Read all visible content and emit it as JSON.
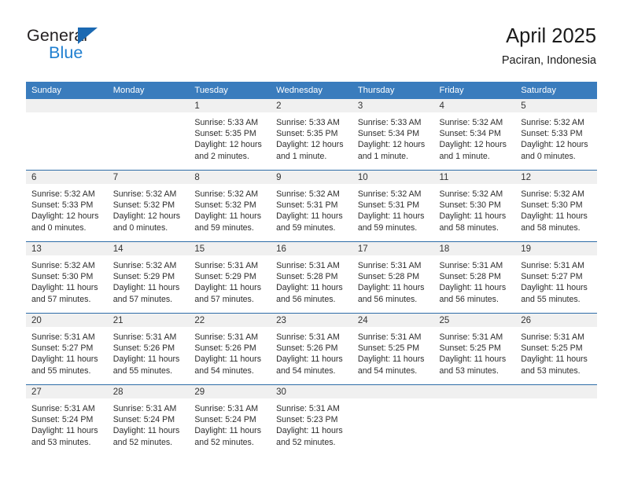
{
  "brand": {
    "name_part1": "General",
    "name_part2": "Blue",
    "triangle_color": "#1b69b2",
    "blue_color": "#1f7fd0"
  },
  "header": {
    "title": "April 2025",
    "subtitle": "Paciran, Indonesia"
  },
  "theme": {
    "header_bar": "#3a7cbd",
    "daynum_band": "#f0f0f0",
    "week_divider": "#2e6da8"
  },
  "weekdays": [
    "Sunday",
    "Monday",
    "Tuesday",
    "Wednesday",
    "Thursday",
    "Friday",
    "Saturday"
  ],
  "labels": {
    "sunrise_prefix": "Sunrise:",
    "sunset_prefix": "Sunset:",
    "daylight_prefix": "Daylight:"
  },
  "weeks": [
    [
      {
        "day": "",
        "empty": true,
        "band": true
      },
      {
        "day": "",
        "empty": true,
        "band": true
      },
      {
        "day": "1",
        "sunrise": "Sunrise: 5:33 AM",
        "sunset": "Sunset: 5:35 PM",
        "daylight1": "Daylight: 12 hours",
        "daylight2": "and 2 minutes."
      },
      {
        "day": "2",
        "sunrise": "Sunrise: 5:33 AM",
        "sunset": "Sunset: 5:35 PM",
        "daylight1": "Daylight: 12 hours",
        "daylight2": "and 1 minute."
      },
      {
        "day": "3",
        "sunrise": "Sunrise: 5:33 AM",
        "sunset": "Sunset: 5:34 PM",
        "daylight1": "Daylight: 12 hours",
        "daylight2": "and 1 minute."
      },
      {
        "day": "4",
        "sunrise": "Sunrise: 5:32 AM",
        "sunset": "Sunset: 5:34 PM",
        "daylight1": "Daylight: 12 hours",
        "daylight2": "and 1 minute."
      },
      {
        "day": "5",
        "sunrise": "Sunrise: 5:32 AM",
        "sunset": "Sunset: 5:33 PM",
        "daylight1": "Daylight: 12 hours",
        "daylight2": "and 0 minutes."
      }
    ],
    [
      {
        "day": "6",
        "sunrise": "Sunrise: 5:32 AM",
        "sunset": "Sunset: 5:33 PM",
        "daylight1": "Daylight: 12 hours",
        "daylight2": "and 0 minutes."
      },
      {
        "day": "7",
        "sunrise": "Sunrise: 5:32 AM",
        "sunset": "Sunset: 5:32 PM",
        "daylight1": "Daylight: 12 hours",
        "daylight2": "and 0 minutes."
      },
      {
        "day": "8",
        "sunrise": "Sunrise: 5:32 AM",
        "sunset": "Sunset: 5:32 PM",
        "daylight1": "Daylight: 11 hours",
        "daylight2": "and 59 minutes."
      },
      {
        "day": "9",
        "sunrise": "Sunrise: 5:32 AM",
        "sunset": "Sunset: 5:31 PM",
        "daylight1": "Daylight: 11 hours",
        "daylight2": "and 59 minutes."
      },
      {
        "day": "10",
        "sunrise": "Sunrise: 5:32 AM",
        "sunset": "Sunset: 5:31 PM",
        "daylight1": "Daylight: 11 hours",
        "daylight2": "and 59 minutes."
      },
      {
        "day": "11",
        "sunrise": "Sunrise: 5:32 AM",
        "sunset": "Sunset: 5:30 PM",
        "daylight1": "Daylight: 11 hours",
        "daylight2": "and 58 minutes."
      },
      {
        "day": "12",
        "sunrise": "Sunrise: 5:32 AM",
        "sunset": "Sunset: 5:30 PM",
        "daylight1": "Daylight: 11 hours",
        "daylight2": "and 58 minutes."
      }
    ],
    [
      {
        "day": "13",
        "sunrise": "Sunrise: 5:32 AM",
        "sunset": "Sunset: 5:30 PM",
        "daylight1": "Daylight: 11 hours",
        "daylight2": "and 57 minutes."
      },
      {
        "day": "14",
        "sunrise": "Sunrise: 5:32 AM",
        "sunset": "Sunset: 5:29 PM",
        "daylight1": "Daylight: 11 hours",
        "daylight2": "and 57 minutes."
      },
      {
        "day": "15",
        "sunrise": "Sunrise: 5:31 AM",
        "sunset": "Sunset: 5:29 PM",
        "daylight1": "Daylight: 11 hours",
        "daylight2": "and 57 minutes."
      },
      {
        "day": "16",
        "sunrise": "Sunrise: 5:31 AM",
        "sunset": "Sunset: 5:28 PM",
        "daylight1": "Daylight: 11 hours",
        "daylight2": "and 56 minutes."
      },
      {
        "day": "17",
        "sunrise": "Sunrise: 5:31 AM",
        "sunset": "Sunset: 5:28 PM",
        "daylight1": "Daylight: 11 hours",
        "daylight2": "and 56 minutes."
      },
      {
        "day": "18",
        "sunrise": "Sunrise: 5:31 AM",
        "sunset": "Sunset: 5:28 PM",
        "daylight1": "Daylight: 11 hours",
        "daylight2": "and 56 minutes."
      },
      {
        "day": "19",
        "sunrise": "Sunrise: 5:31 AM",
        "sunset": "Sunset: 5:27 PM",
        "daylight1": "Daylight: 11 hours",
        "daylight2": "and 55 minutes."
      }
    ],
    [
      {
        "day": "20",
        "sunrise": "Sunrise: 5:31 AM",
        "sunset": "Sunset: 5:27 PM",
        "daylight1": "Daylight: 11 hours",
        "daylight2": "and 55 minutes."
      },
      {
        "day": "21",
        "sunrise": "Sunrise: 5:31 AM",
        "sunset": "Sunset: 5:26 PM",
        "daylight1": "Daylight: 11 hours",
        "daylight2": "and 55 minutes."
      },
      {
        "day": "22",
        "sunrise": "Sunrise: 5:31 AM",
        "sunset": "Sunset: 5:26 PM",
        "daylight1": "Daylight: 11 hours",
        "daylight2": "and 54 minutes."
      },
      {
        "day": "23",
        "sunrise": "Sunrise: 5:31 AM",
        "sunset": "Sunset: 5:26 PM",
        "daylight1": "Daylight: 11 hours",
        "daylight2": "and 54 minutes."
      },
      {
        "day": "24",
        "sunrise": "Sunrise: 5:31 AM",
        "sunset": "Sunset: 5:25 PM",
        "daylight1": "Daylight: 11 hours",
        "daylight2": "and 54 minutes."
      },
      {
        "day": "25",
        "sunrise": "Sunrise: 5:31 AM",
        "sunset": "Sunset: 5:25 PM",
        "daylight1": "Daylight: 11 hours",
        "daylight2": "and 53 minutes."
      },
      {
        "day": "26",
        "sunrise": "Sunrise: 5:31 AM",
        "sunset": "Sunset: 5:25 PM",
        "daylight1": "Daylight: 11 hours",
        "daylight2": "and 53 minutes."
      }
    ],
    [
      {
        "day": "27",
        "sunrise": "Sunrise: 5:31 AM",
        "sunset": "Sunset: 5:24 PM",
        "daylight1": "Daylight: 11 hours",
        "daylight2": "and 53 minutes."
      },
      {
        "day": "28",
        "sunrise": "Sunrise: 5:31 AM",
        "sunset": "Sunset: 5:24 PM",
        "daylight1": "Daylight: 11 hours",
        "daylight2": "and 52 minutes."
      },
      {
        "day": "29",
        "sunrise": "Sunrise: 5:31 AM",
        "sunset": "Sunset: 5:24 PM",
        "daylight1": "Daylight: 11 hours",
        "daylight2": "and 52 minutes."
      },
      {
        "day": "30",
        "sunrise": "Sunrise: 5:31 AM",
        "sunset": "Sunset: 5:23 PM",
        "daylight1": "Daylight: 11 hours",
        "daylight2": "and 52 minutes."
      },
      {
        "day": "",
        "empty": true,
        "band": true
      },
      {
        "day": "",
        "empty": true,
        "band": true
      },
      {
        "day": "",
        "empty": true,
        "band": true
      }
    ]
  ]
}
